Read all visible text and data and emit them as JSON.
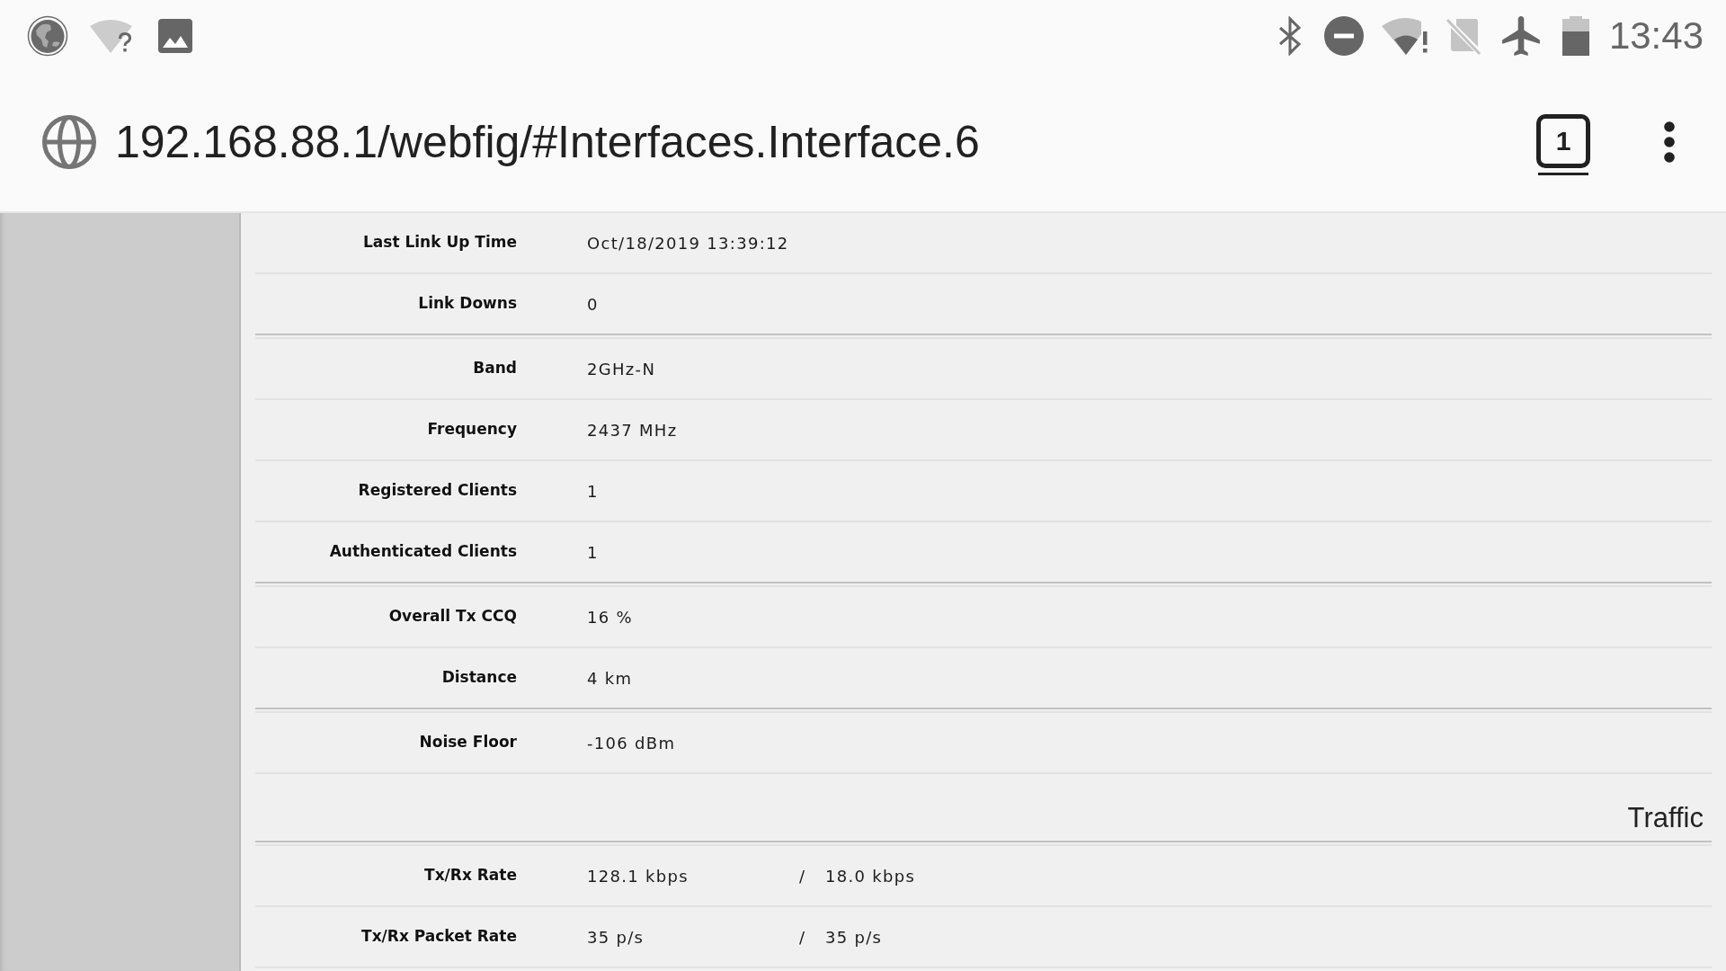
{
  "status_bar": {
    "time": "13:43"
  },
  "address_bar": {
    "url": "192.168.88.1/webfig/#Interfaces.Interface.6",
    "tab_count": "1"
  },
  "sections": [
    {
      "kind": "group",
      "rows": [
        {
          "kind": "single",
          "label": "Last Link Up Time",
          "value": "Oct/18/2019 13:39:12"
        },
        {
          "kind": "single",
          "label": "Link Downs",
          "value": "0"
        }
      ]
    },
    {
      "kind": "group",
      "rows": [
        {
          "kind": "single",
          "label": "Band",
          "value": "2GHz-N"
        },
        {
          "kind": "single",
          "label": "Frequency",
          "value": "2437 MHz"
        },
        {
          "kind": "single",
          "label": "Registered Clients",
          "value": "1"
        },
        {
          "kind": "single",
          "label": "Authenticated Clients",
          "value": "1"
        }
      ]
    },
    {
      "kind": "group",
      "rows": [
        {
          "kind": "single",
          "label": "Overall Tx CCQ",
          "value": "16 %"
        },
        {
          "kind": "single",
          "label": "Distance",
          "value": "4 km"
        }
      ]
    },
    {
      "kind": "group",
      "rows": [
        {
          "kind": "single",
          "label": "Noise Floor",
          "value": "-106 dBm"
        }
      ]
    },
    {
      "kind": "heading",
      "title": "Traffic"
    },
    {
      "kind": "group",
      "rows": [
        {
          "kind": "pair",
          "label": "Tx/Rx Rate",
          "tx": "128.1 kbps",
          "separator": "/",
          "rx": "18.0 kbps"
        },
        {
          "kind": "pair",
          "label": "Tx/Rx Packet Rate",
          "tx": "35 p/s",
          "separator": "/",
          "rx": "35 p/s"
        }
      ]
    }
  ]
}
